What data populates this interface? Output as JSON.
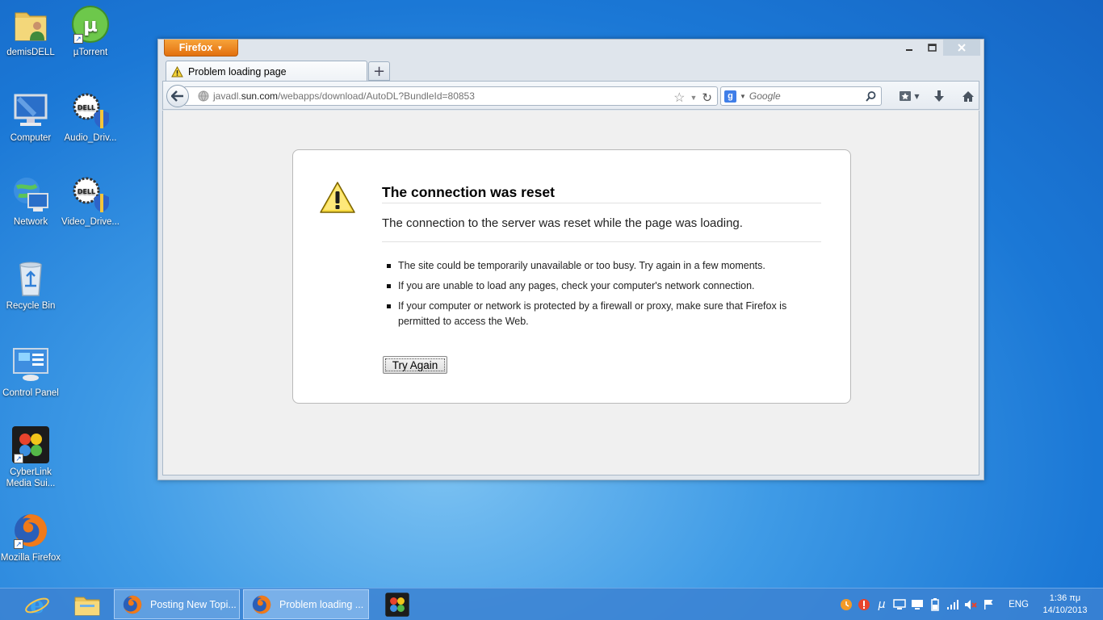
{
  "desktop": {
    "icons": [
      {
        "label": "demisDELL"
      },
      {
        "label": "µTorrent"
      },
      {
        "label": "Computer"
      },
      {
        "label": "Audio_Driv..."
      },
      {
        "label": "Network"
      },
      {
        "label": "Video_Drive..."
      },
      {
        "label": "Recycle Bin"
      },
      {
        "label": "Control Panel"
      },
      {
        "label": "CyberLink Media Sui..."
      },
      {
        "label": "Mozilla Firefox"
      }
    ]
  },
  "browser": {
    "menu_label": "Firefox",
    "tab_title": "Problem loading page",
    "url_prefix": "javadl.",
    "url_domain": "sun.com",
    "url_path": "/webapps/download/AutoDL?BundleId=80853",
    "search_placeholder": "Google",
    "error": {
      "title": "The connection was reset",
      "description": "The connection to the server was reset while the page was loading.",
      "items": [
        "The site could be temporarily unavailable or too busy. Try again in a few moments.",
        "If you are unable to load any pages, check your computer's network connection.",
        "If your computer or network is protected by a firewall or proxy, make sure that Firefox is permitted to access the Web."
      ],
      "button_label": "Try Again"
    }
  },
  "taskbar": {
    "tasks": [
      {
        "label": "Posting New Topi..."
      },
      {
        "label": "Problem loading ..."
      }
    ],
    "language": "ENG",
    "time": "1:36 πμ",
    "date": "14/10/2013"
  },
  "colors": {
    "firefox_orange": "#e2700f",
    "taskbar_blue": "#3c82d2",
    "desktop_blue": "#1b78d6"
  }
}
